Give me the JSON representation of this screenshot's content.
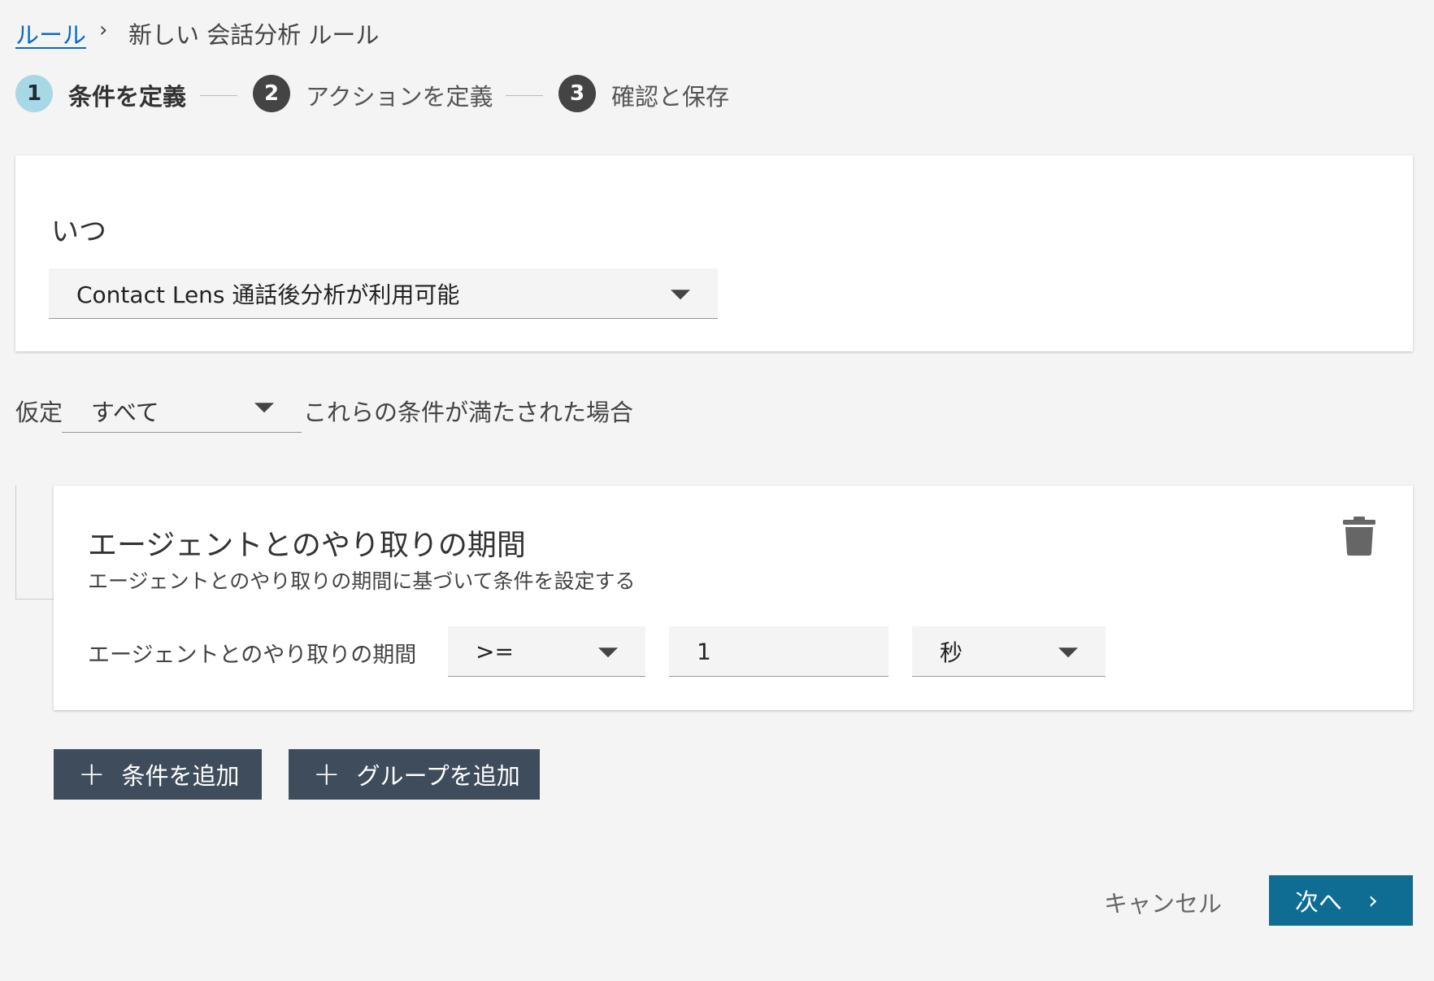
{
  "breadcrumb": {
    "root": "ルール",
    "separator": "›",
    "current": "新しい 会話分析 ルール"
  },
  "steps": [
    {
      "number": "1",
      "label": "条件を定義"
    },
    {
      "number": "2",
      "label": "アクションを定義"
    },
    {
      "number": "3",
      "label": "確認と保存"
    }
  ],
  "when": {
    "title": "いつ",
    "trigger": "Contact Lens 通話後分析が利用可能"
  },
  "assume": {
    "prefix": "仮定",
    "match": "すべて",
    "suffix": "これらの条件が満たされた場合"
  },
  "condition": {
    "title": "エージェントとのやり取りの期間",
    "subtitle": "エージェントとのやり取りの期間に基づいて条件を設定する",
    "field_label": "エージェントとのやり取りの期間",
    "operator": ">=",
    "value": "1",
    "unit": "秒",
    "delete_icon": "trash-icon"
  },
  "actions": {
    "add_condition": "条件を追加",
    "add_group": "グループを追加",
    "plus": "+"
  },
  "footer": {
    "cancel": "キャンセル",
    "next": "次へ",
    "next_chevron": "›"
  },
  "colors": {
    "link": "#0a6cc2",
    "active_step": "#a8d8e5",
    "dark_button": "#3f4c5c",
    "primary": "#0f6d94"
  }
}
